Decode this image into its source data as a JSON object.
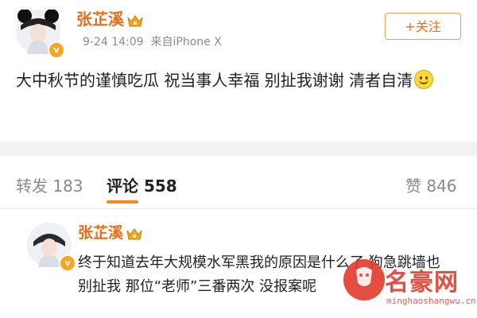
{
  "post": {
    "username": "张芷溪",
    "timestamp": "9-24 14:09",
    "source": "来自iPhone X",
    "follow_label": "+关注",
    "text": "大中秋节的谨慎吃瓜 祝当事人幸福 别扯我谢谢 清者自清",
    "avatar_badge": "v",
    "emoji_icon": "smile-emoji-icon"
  },
  "tabs": [
    {
      "label": "转发 183"
    },
    {
      "label": "评论 558"
    },
    {
      "label": "赞 846"
    }
  ],
  "comment": {
    "username": "张芷溪",
    "text": "终于知道去年大规模水军黑我的原因是什么了 狗急跳墙也别扯我 那位“老师”三番两次 没报案呢",
    "avatar_badge": "v"
  },
  "watermark": {
    "text": "名豪网",
    "subtext": "minghaoshangwu.cn"
  },
  "colors": {
    "username": "#e86c1a",
    "accent": "#f08a24",
    "badge": "#f5a623",
    "watermark": "#e23a2c"
  }
}
